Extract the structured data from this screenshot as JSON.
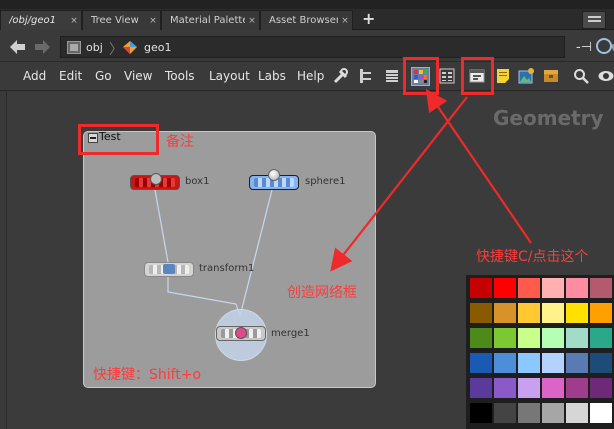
{
  "tabs": [
    {
      "label": "/obj/geo1",
      "close": "×"
    },
    {
      "label": "Tree View",
      "close": "×"
    },
    {
      "label": "Material Palette",
      "close": "×"
    },
    {
      "label": "Asset Browser",
      "close": "×"
    }
  ],
  "tab_add": "+",
  "path": {
    "back_icon": "arrow-left-icon",
    "forward_icon": "arrow-right-icon",
    "segments": [
      {
        "label": "obj",
        "icon": "obj-context-icon"
      },
      {
        "label": "geo1",
        "icon": "geo-node-icon"
      }
    ],
    "dropdown_glyph": "▼",
    "pin_glyph": "-⊣"
  },
  "menu": [
    "Add",
    "Edit",
    "Go",
    "View",
    "Tools",
    "Layout",
    "Labs",
    "Help"
  ],
  "toolbar_icons": [
    "wrench-icon",
    "tree-layout-icon",
    "list-view-icon",
    "color-palette-icon",
    "grid-view-icon",
    "network-box-icon",
    "sticky-note-icon",
    "image-icon",
    "asset-box-icon",
    "magnifier-icon",
    "eye-icon"
  ],
  "network": {
    "context_label": "Geometry",
    "netbox_title": "Test",
    "nodes": [
      {
        "name": "box1",
        "type": "box",
        "color": "#c81616"
      },
      {
        "name": "sphere1",
        "type": "sphere",
        "color": "#86b4f0"
      },
      {
        "name": "transform1",
        "type": "transform",
        "color": "#d4d4d4"
      },
      {
        "name": "merge1",
        "type": "merge",
        "color": "#c8c8c8"
      }
    ]
  },
  "palette": {
    "colors": [
      [
        "#c70000",
        "#ff0000",
        "#ff5a4c",
        "#ffb0b0",
        "#ff8ca0",
        "#b35a6e"
      ],
      [
        "#8a5a00",
        "#d7922a",
        "#ffc832",
        "#fff28a",
        "#ffe000",
        "#ffa000"
      ],
      [
        "#4c8a1a",
        "#7cc832",
        "#c8ff8a",
        "#b4ffb4",
        "#a0dcc8",
        "#2aa88a"
      ],
      [
        "#1a5ab4",
        "#4c8ed7",
        "#8ac8ff",
        "#b4d2ff",
        "#5a7ab4",
        "#1e4c78"
      ],
      [
        "#5a3a9a",
        "#8a5ac8",
        "#c8a0f0",
        "#dc64c8",
        "#a03c8c",
        "#6e2a78"
      ],
      [
        "#000000",
        "#444444",
        "#777777",
        "#a6a6a6",
        "#d6d6d6",
        "#ffffff"
      ]
    ]
  },
  "annotations": {
    "note": "备注",
    "create_box": "创造网络框",
    "shortcut_c": "快捷键C/点击这个",
    "shortcut_shift": "快捷键：Shift+o"
  },
  "colors": {
    "annotation": "#ee2a2a",
    "netbox": "#9c9c9c"
  }
}
